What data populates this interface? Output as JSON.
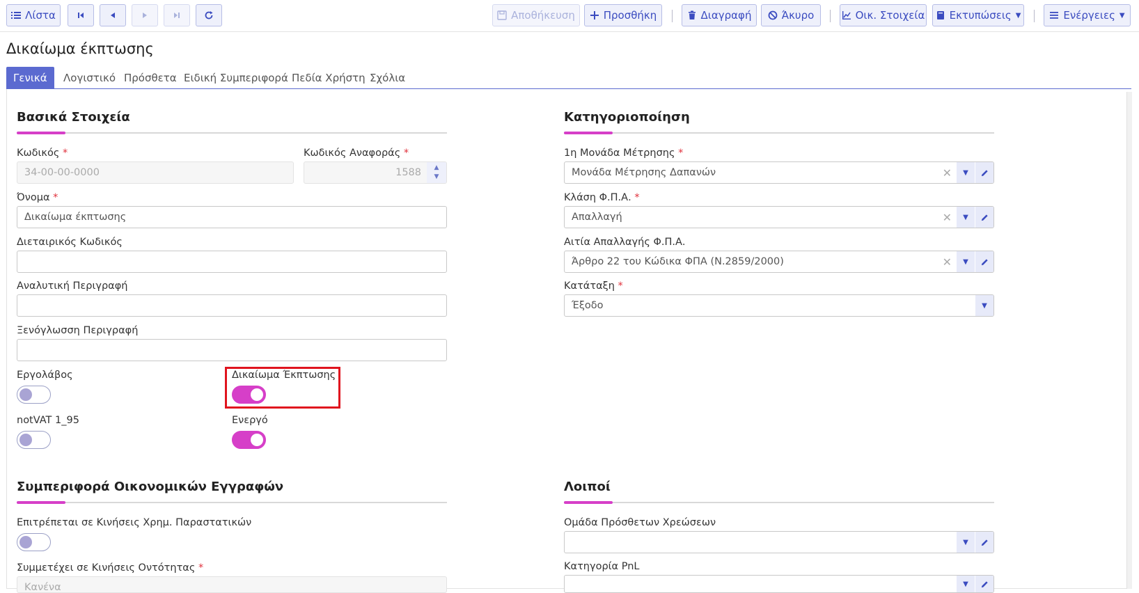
{
  "toolbar": {
    "list_label": "Λίστα",
    "save_label": "Αποθήκευση",
    "add_label": "Προσθήκη",
    "delete_label": "Διαγραφή",
    "cancel_label": "Άκυρο",
    "financial_label": "Οικ. Στοιχεία",
    "prints_label": "Εκτυπώσεις",
    "actions_label": "Ενέργειες"
  },
  "page": {
    "title": "Δικαίωμα έκπτωσης"
  },
  "tabs": [
    {
      "label": "Γενικά",
      "active": true
    },
    {
      "label": "Λογιστικό"
    },
    {
      "label": "Πρόσθετα"
    },
    {
      "label": "Ειδική Συμπεριφορά"
    },
    {
      "label": "Πεδία Χρήστη"
    },
    {
      "label": "Σχόλια"
    }
  ],
  "basic": {
    "title": "Βασικά Στοιχεία",
    "code_label": "Κωδικός",
    "code_value": "34-00-00-0000",
    "ref_code_label": "Κωδικός Αναφοράς",
    "ref_code_value": "1588",
    "name_label": "Όνομα",
    "name_value": "Δικαίωμα έκπτωσης",
    "company_code_label": "Διεταιρικός Κωδικός",
    "company_code_value": "",
    "detailed_desc_label": "Αναλυτική Περιγραφή",
    "detailed_desc_value": "",
    "foreign_desc_label": "Ξενόγλωσση Περιγραφή",
    "foreign_desc_value": "",
    "contractor_label": "Εργολάβος",
    "contractor_on": false,
    "deduction_right_label": "Δικαίωμα Έκπτωσης",
    "deduction_right_on": true,
    "notvat_label": "notVAT 1_95",
    "notvat_on": false,
    "active_label": "Ενεργό",
    "active_on": true
  },
  "classification": {
    "title": "Κατηγοριοποίηση",
    "uom_label": "1η Μονάδα Μέτρησης",
    "uom_value": "Μονάδα Μέτρησης Δαπανών",
    "vat_class_label": "Κλάση Φ.Π.Α.",
    "vat_class_value": "Απαλλαγή",
    "vat_exempt_label": "Αιτία Απαλλαγής Φ.Π.Α.",
    "vat_exempt_value": "Άρθρο 22 του Κώδικα ΦΠΑ (Ν.2859/2000)",
    "category_label": "Κατάταξη",
    "category_value": "Έξοδο"
  },
  "behavior": {
    "title": "Συμπεριφορά Οικονομικών Εγγραφών",
    "allowed_label": "Επιτρέπεται σε Κινήσεις Χρημ. Παραστατικών",
    "allowed_on": false,
    "participates_label": "Συμμετέχει σε Κινήσεις Οντότητας",
    "participates_value": "Κανένα"
  },
  "other": {
    "title": "Λοιποί",
    "charges_group_label": "Ομάδα Πρόσθετων Χρεώσεων",
    "charges_group_value": "",
    "pnl_label": "Κατηγορία PnL",
    "pnl_value": ""
  },
  "colors": {
    "accent": "#5b6ad0",
    "toggle_on": "#d63fc8",
    "highlight": "#e0141e"
  }
}
